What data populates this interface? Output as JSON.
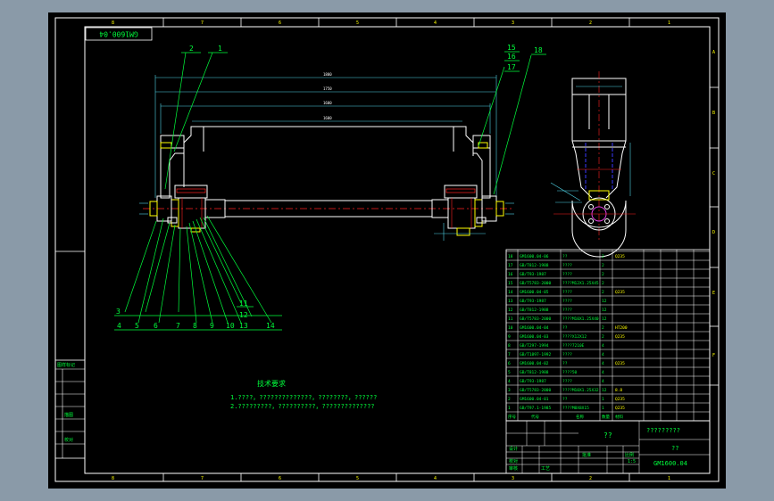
{
  "colors": {
    "background": "#000000",
    "frame": "#ffffff",
    "green": "#00ff3c",
    "cyan": "#4fd3e6",
    "yellow": "#ffff00",
    "red": "#ff2020",
    "blue": "#3a3aff",
    "magenta": "#e040e0",
    "outer": "#8a9aa8"
  },
  "drawing_no_rotated": "GM1600.04",
  "drawing_no": "GM1600.04",
  "title_cn": "??",
  "title_box_top": "?????????",
  "title_box_right": "??",
  "technical_requirements_title": "技术要求",
  "technical_requirements": [
    "1.????，??????????????，????????，??????",
    "2.?????????，??????????，??????????????"
  ],
  "balloons_top": [
    "2",
    "1",
    "15",
    "16",
    "17",
    "18"
  ],
  "balloons_bottom": [
    "3",
    "4",
    "5",
    "6",
    "7",
    "8",
    "9",
    "10",
    "13",
    "11",
    "12",
    "14"
  ],
  "zone_letters": [
    "A",
    "B",
    "C",
    "D",
    "E",
    "F"
  ],
  "zone_numbers": [
    "8",
    "7",
    "6",
    "5",
    "4",
    "3",
    "2",
    "1"
  ],
  "bom_rows": [
    [
      "18",
      "GM1600.04-06",
      "??",
      "2",
      "Q235"
    ],
    [
      "17",
      "GB/T812-1988",
      "????",
      "2",
      ""
    ],
    [
      "16",
      "GB/T93-1987",
      "????",
      "2",
      ""
    ],
    [
      "15",
      "GB/T5783-2000",
      "????M12X1.25X45",
      "2",
      ""
    ],
    [
      "14",
      "GM1600.04-05",
      "????",
      "2",
      "Q235"
    ],
    [
      "13",
      "GB/T93-1987",
      "????",
      "12",
      ""
    ],
    [
      "12",
      "GB/T812-1988",
      "????",
      "12",
      ""
    ],
    [
      "11",
      "GB/T5783-2000",
      "????M10X1.25X40",
      "12",
      ""
    ],
    [
      "10",
      "GM1600.04-04",
      "??",
      "2",
      "HT200"
    ],
    [
      "9",
      "GM1600.04-03",
      "????X12X12",
      "2",
      "Q235"
    ],
    [
      "8",
      "GB/T297-1994",
      "????7210E",
      "4",
      ""
    ],
    [
      "7",
      "GB/T1897-1992",
      "????",
      "4",
      ""
    ],
    [
      "6",
      "GM1600.04-02",
      "??",
      "4",
      "Q235"
    ],
    [
      "5",
      "GB/T812-1988",
      "????50",
      "4",
      ""
    ],
    [
      "4",
      "GB/T93-1987",
      "????",
      "4",
      ""
    ],
    [
      "3",
      "GB/T5783-2000",
      "????M10X1.25X32",
      "12",
      "8.8"
    ],
    [
      "2",
      "GM1600.04-01",
      "??",
      "1",
      "Q235"
    ],
    [
      "1",
      "GB/T97.1-1985",
      "????M8X8X15",
      "1",
      "Q235"
    ]
  ],
  "bom_header": [
    "序号",
    "代号",
    "名称",
    "数量",
    "材料"
  ],
  "left_side_box": [
    "图样标记",
    "",
    "",
    "",
    "描图",
    "",
    "",
    "校对"
  ],
  "title_block_labels": [
    "设计",
    "校对",
    "审核",
    "工艺",
    "批准",
    "比例",
    "1:5"
  ]
}
